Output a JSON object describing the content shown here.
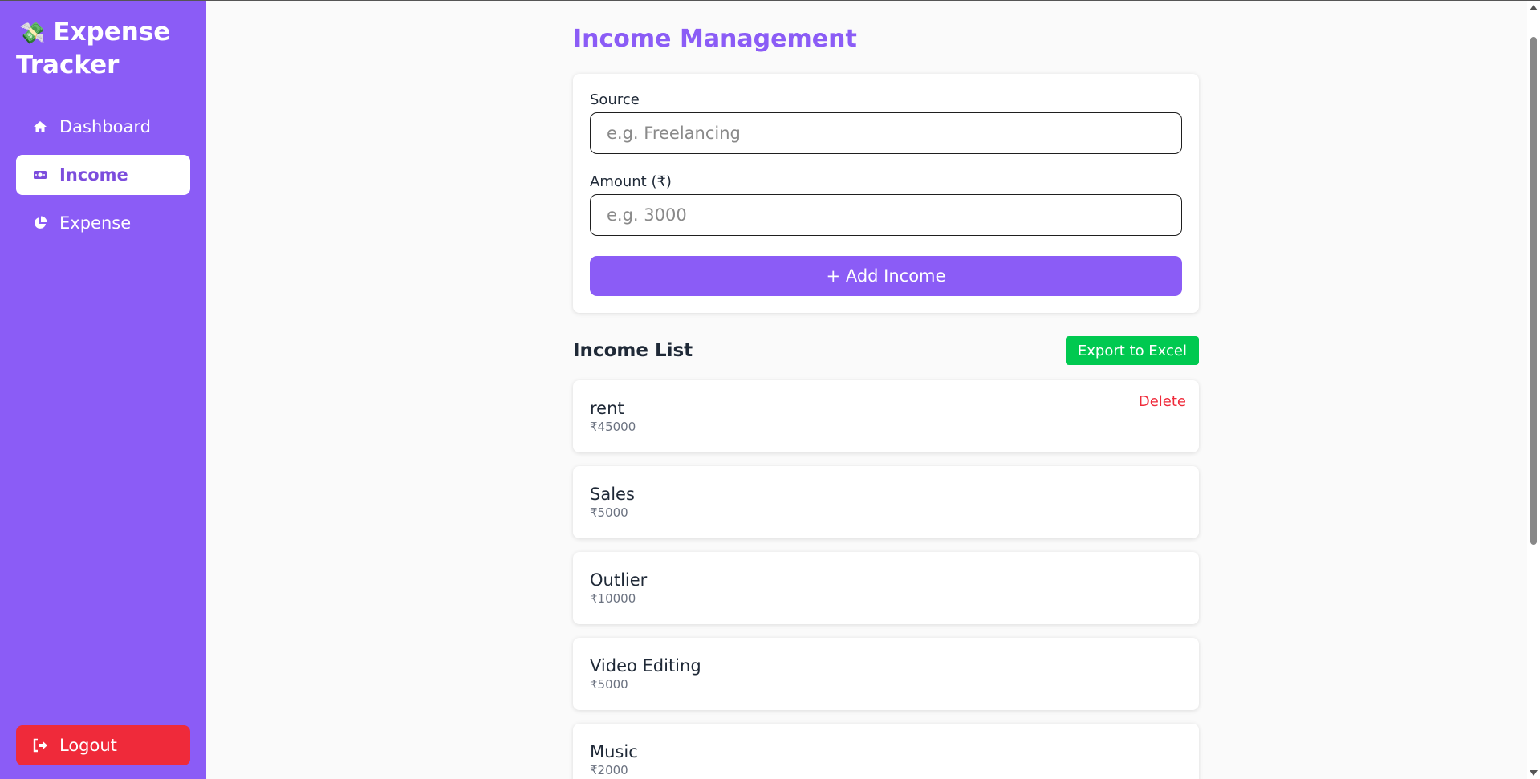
{
  "sidebar": {
    "logo_icon": "💸",
    "brand_line1": "Expense",
    "brand_line2": "Tracker",
    "items": [
      {
        "label": "Dashboard",
        "icon": "home-icon",
        "active": false
      },
      {
        "label": "Income",
        "icon": "money-icon",
        "active": true
      },
      {
        "label": "Expense",
        "icon": "pie-chart-icon",
        "active": false
      }
    ],
    "logout_label": "Logout",
    "logout_icon": "sign-out-icon"
  },
  "main": {
    "title": "Income Management",
    "form": {
      "source_label": "Source",
      "source_placeholder": "e.g. Freelancing",
      "source_value": "",
      "amount_label": "Amount (₹)",
      "amount_placeholder": "e.g. 3000",
      "amount_value": "",
      "submit_label": "+ Add Income"
    },
    "list_title": "Income List",
    "export_label": "Export to Excel",
    "delete_label": "Delete",
    "items": [
      {
        "source": "rent",
        "amount": "₹45000",
        "show_delete": true
      },
      {
        "source": "Sales",
        "amount": "₹5000",
        "show_delete": false
      },
      {
        "source": "Outlier",
        "amount": "₹10000",
        "show_delete": false
      },
      {
        "source": "Video Editing",
        "amount": "₹5000",
        "show_delete": false
      },
      {
        "source": "Music",
        "amount": "₹2000",
        "show_delete": false
      }
    ]
  },
  "colors": {
    "primary": "#8b5cf6",
    "export_green": "#00c950",
    "danger_red": "#ef2a3a",
    "page_bg": "#fafafa"
  }
}
